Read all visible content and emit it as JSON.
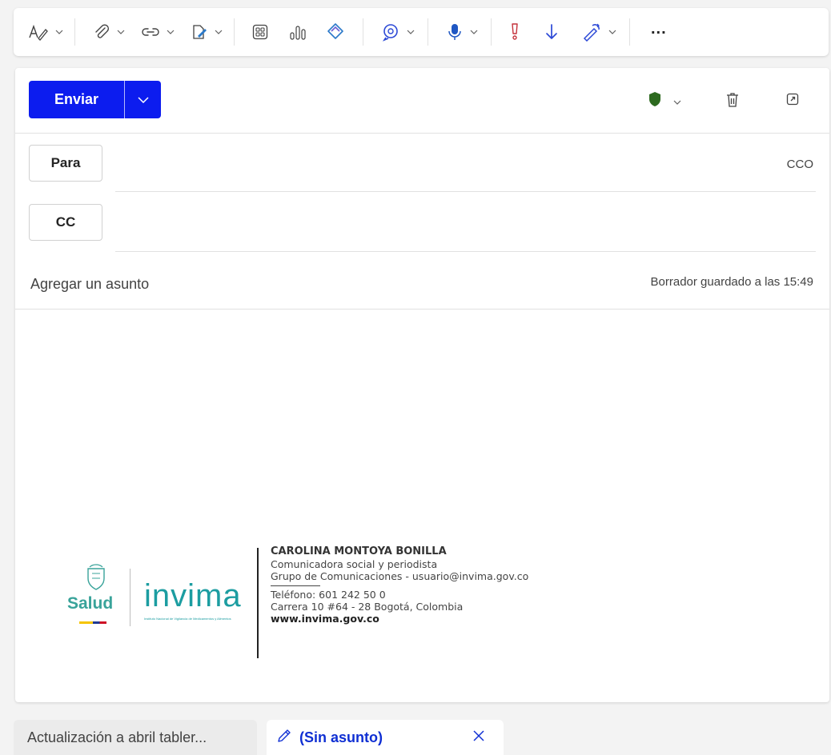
{
  "colors": {
    "accent": "#0c1cef",
    "shield": "#2d6a1f",
    "tab_active_text": "#0f2fd3",
    "teal": "#1c9da1",
    "exclamation": "#c4313a"
  },
  "toolbar": {
    "icons": [
      "format-text-icon",
      "attach-icon",
      "link-icon",
      "signature-icon",
      "apps-icon",
      "poll-icon",
      "loop-icon",
      "copilot-icon",
      "dictate-icon",
      "high-importance-icon",
      "low-importance-icon",
      "editor-icon",
      "more-icon"
    ],
    "more_label": "..."
  },
  "compose": {
    "send_label": "Enviar",
    "to_label": "Para",
    "cc_label": "CC",
    "bcc_label": "CCO",
    "subject_placeholder": "Agregar un asunto",
    "draft_status": "Borrador guardado a las 15:49"
  },
  "signature": {
    "name": "CAROLINA MONTOYA BONILLA",
    "role": "Comunicadora social y periodista",
    "group": "Grupo de Comunicaciones - usuario@invima.gov.co",
    "phone": "Teléfono: 601 242 50 0",
    "address": "Carrera 10 #64 - 28 Bogotá, Colombia",
    "web": "www.invima.gov.co",
    "logo_left": "Salud",
    "logo_right": "invima",
    "logo_right_subtitle": "Instituto Nacional de Vigilancia de Medicamentos y Alimentos"
  },
  "tabs": [
    {
      "label": "Actualización a abril tabler..."
    },
    {
      "label": "(Sin asunto)"
    }
  ]
}
